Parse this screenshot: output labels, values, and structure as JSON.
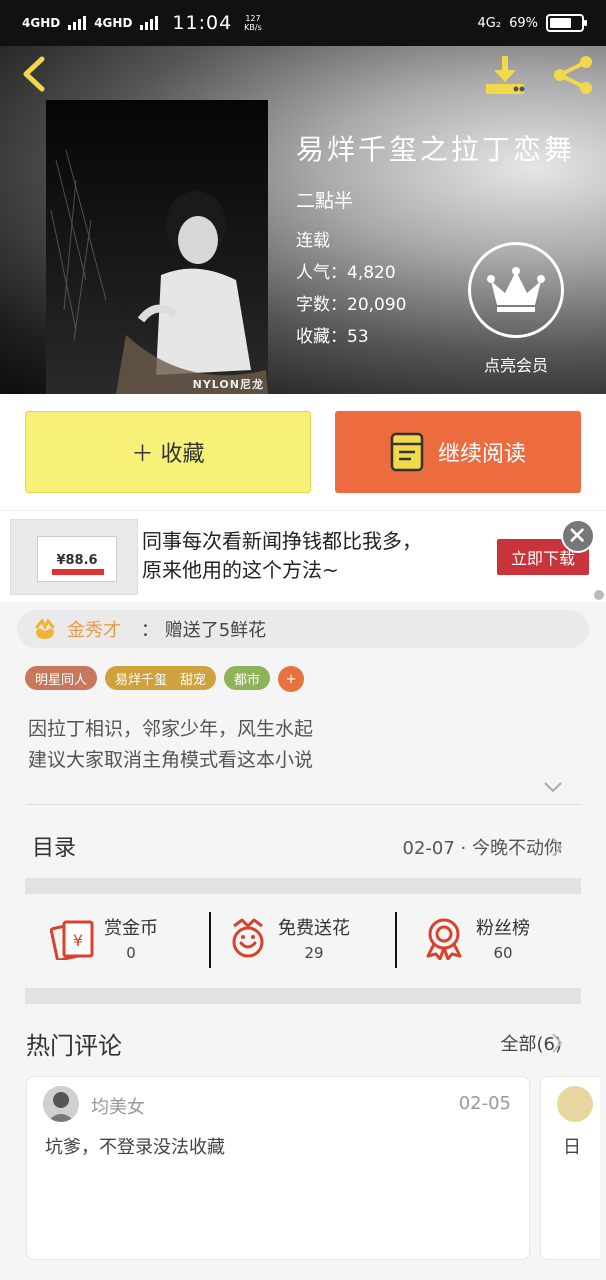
{
  "status_bar": {
    "net1": "4GHD",
    "net2": "4GHD",
    "time": "11:04",
    "speed_value": "127",
    "speed_unit": "KB/s",
    "net3": "4G₂",
    "battery": "69%",
    "battery_level": 0.69
  },
  "book": {
    "title": "易烊千玺之拉丁恋舞",
    "author": "二點半",
    "status": "连载",
    "popularity": "人气：4,820",
    "word_count": "字数：20,090",
    "favorites": "收藏：53",
    "cover_caption": "NYLON尼龙"
  },
  "vip": {
    "label": "点亮会员"
  },
  "actions": {
    "favorite": "＋ 收藏",
    "continue_reading": "继续阅读"
  },
  "ad": {
    "line1": "同事每次看新闻挣钱都比我多，",
    "line2": "原来他用的这个方法~",
    "cta": "立即下载",
    "thumb_amount": "¥88.6"
  },
  "gift": {
    "user": "金秀才",
    "message": "： 赠送了5鲜花"
  },
  "tags": [
    {
      "label": "明星同人",
      "color": "#c8785a"
    },
    {
      "label": "易烊千玺　甜宠",
      "color": "#cfa23d"
    },
    {
      "label": "都市",
      "color": "#8fb35a"
    },
    {
      "label": "+",
      "color": "#e8723f"
    }
  ],
  "description": {
    "line1": "因拉丁相识，邻家少年，风生水起",
    "line2": "建议大家取消主角模式看这本小说"
  },
  "toc": {
    "title": "目录",
    "latest": "02-07 · 今晚不动你"
  },
  "stats": {
    "coins_label": "赏金币",
    "coins_value": "0",
    "flowers_label": "免费送花",
    "flowers_value": "29",
    "fans_label": "粉丝榜",
    "fans_value": "60"
  },
  "comments": {
    "title": "热门评论",
    "all": "全部(6)",
    "items": [
      {
        "user": "均美女",
        "date": "02-05",
        "text": "坑爹，不登录没法收藏"
      },
      {
        "text": "日"
      }
    ]
  },
  "colors": {
    "yellow_button": "#f7f079",
    "orange_button": "#ec6b3f",
    "icon_yellow": "#f2d94c",
    "icon_red": "#d9412b",
    "ad_cta": "#c9333a"
  },
  "icons": {
    "back": "chevron-left-icon",
    "download": "download-icon",
    "share": "share-icon",
    "vip": "crown-icon",
    "book": "book-icon",
    "close": "close-icon",
    "gift": "flower-icon",
    "coins": "red-envelope-icon",
    "flowers": "flower-face-icon",
    "fans": "ribbon-medal-icon"
  }
}
